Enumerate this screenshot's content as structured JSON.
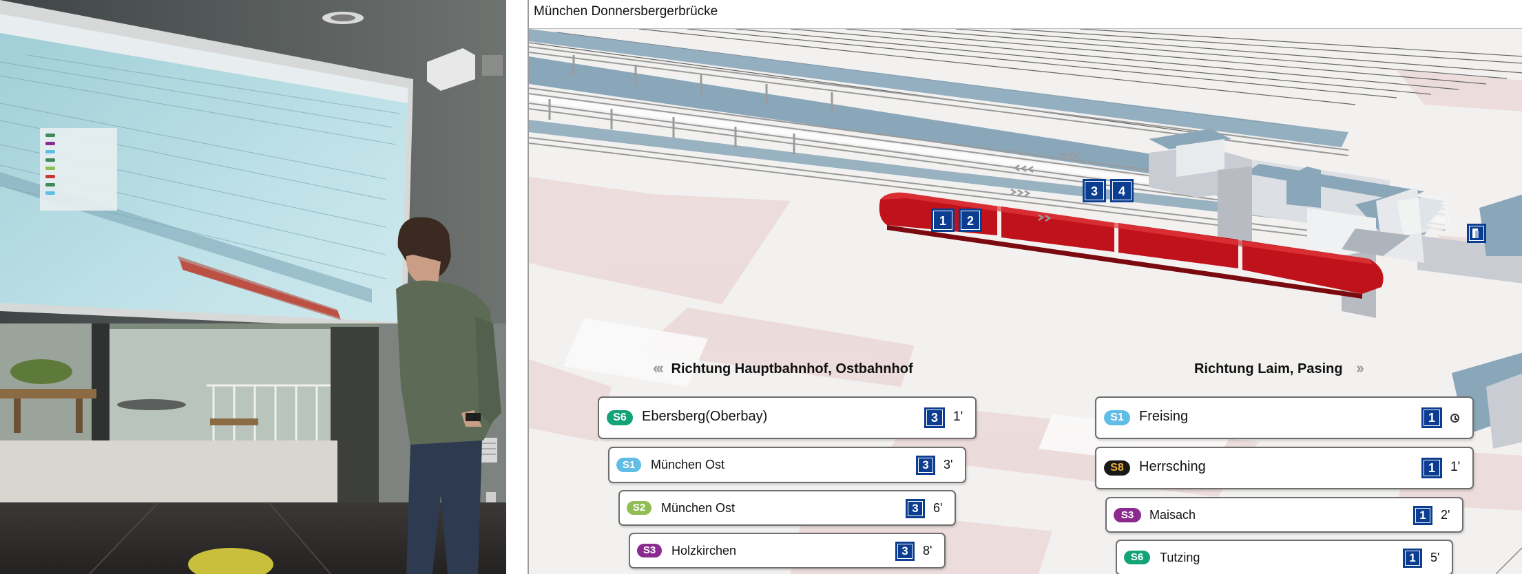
{
  "window": {
    "title": "München Donnersbergerbrücke"
  },
  "platform_markers": [
    "1",
    "2",
    "3",
    "4"
  ],
  "directions": {
    "left": {
      "arrows": "‹‹‹",
      "label": "Richtung Hauptbahnhof, Ostbahnhof"
    },
    "right": {
      "arrows": "››",
      "label": "Richtung Laim, Pasing"
    }
  },
  "departures_left": [
    {
      "line": "S6",
      "color": "#13a377",
      "text_color": "#ffffff",
      "destination": "Ebersberg(Oberbay)",
      "platform": "3",
      "minutes": "1'"
    },
    {
      "line": "S1",
      "color": "#5fbde6",
      "text_color": "#ffffff",
      "destination": "München Ost",
      "platform": "3",
      "minutes": "3'"
    },
    {
      "line": "S2",
      "color": "#8fbf53",
      "text_color": "#ffffff",
      "destination": "München Ost",
      "platform": "3",
      "minutes": "6'"
    },
    {
      "line": "S3",
      "color": "#8c2b8f",
      "text_color": "#ffffff",
      "destination": "Holzkirchen",
      "platform": "3",
      "minutes": "8'"
    }
  ],
  "departures_right": [
    {
      "line": "S1",
      "color": "#5fbde6",
      "text_color": "#ffffff",
      "destination": "Freising",
      "platform": "1",
      "minutes": "",
      "icon": "clock-icon"
    },
    {
      "line": "S8",
      "color": "#1a1a1a",
      "text_color": "#f2b233",
      "destination": "Herrsching",
      "platform": "1",
      "minutes": "1'"
    },
    {
      "line": "S3",
      "color": "#8c2b8f",
      "text_color": "#ffffff",
      "destination": "Maisach",
      "platform": "1",
      "minutes": "2'"
    },
    {
      "line": "S6",
      "color": "#13a377",
      "text_color": "#ffffff",
      "destination": "Tutzing",
      "platform": "1",
      "minutes": "5'"
    }
  ],
  "icons": {
    "exit": "exit-door-icon",
    "clock": "clock-icon"
  }
}
